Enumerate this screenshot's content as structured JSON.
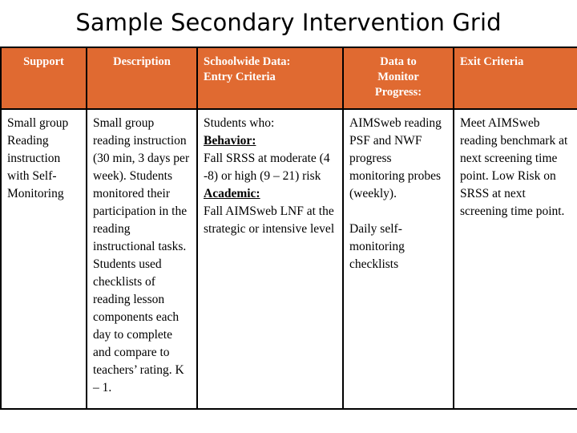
{
  "slide": {
    "title": "Sample Secondary Intervention Grid"
  },
  "theme": {
    "header_fill": "#E06A31",
    "header_text": "#FFFFFF",
    "body_text": "#000000",
    "border": "#000000",
    "page_background": "#FFFFFF"
  },
  "table": {
    "columns": [
      {
        "key": "support",
        "header": "Support",
        "align": "center"
      },
      {
        "key": "description",
        "header": "Description",
        "align": "center"
      },
      {
        "key": "entry",
        "header": "Schoolwide Data:\nEntry Criteria",
        "header_line1": "Schoolwide Data:",
        "header_line2": "Entry Criteria",
        "align": "left"
      },
      {
        "key": "monitor",
        "header": "Data to Monitor Progress:",
        "header_line1": "Data to",
        "header_line2": "Monitor",
        "header_line3": "Progress:",
        "align": "center"
      },
      {
        "key": "exit",
        "header": "Exit Criteria",
        "align": "left"
      }
    ],
    "rows": [
      {
        "support": "Small group Reading instruction with Self-Monitoring",
        "description": "Small group reading instruction (30 min, 3 days per week). Students monitored their participation in the reading instructional tasks. Students used checklists of reading lesson components each day to complete and compare to teachers’ rating. K – 1.",
        "entry": {
          "intro": "Students who:",
          "behavior_label": "Behavior:",
          "behavior_text": "Fall SRSS at moderate (4 -8) or high (9 – 21) risk",
          "academic_label": "Academic:",
          "academic_text": "Fall AIMSweb LNF at the strategic or intensive level"
        },
        "monitor": {
          "part1": "AIMSweb reading PSF and NWF progress monitoring probes (weekly).",
          "part2": "Daily self-monitoring checklists"
        },
        "exit": "Meet AIMSweb reading benchmark at next screening time point. Low Risk on SRSS at next screening time point."
      }
    ]
  }
}
